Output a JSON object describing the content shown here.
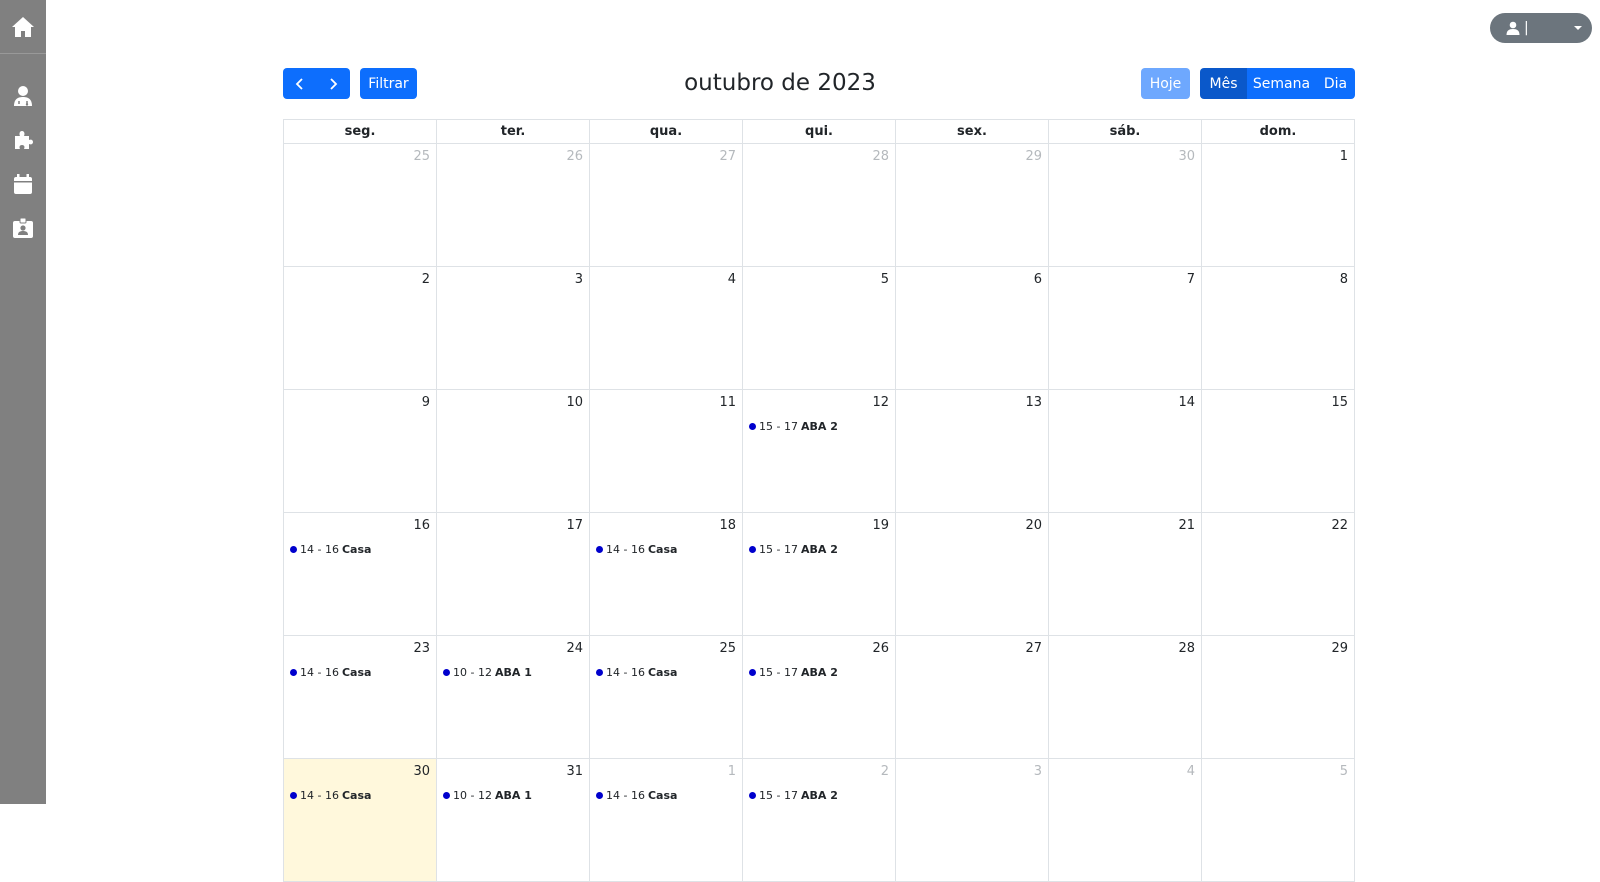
{
  "sidebar": {
    "items": [
      {
        "icon": "home-icon"
      },
      {
        "icon": "user-doctor-icon"
      },
      {
        "icon": "puzzle-icon"
      },
      {
        "icon": "calendar-icon"
      },
      {
        "icon": "id-badge-icon"
      }
    ]
  },
  "user_menu": {
    "name": "|"
  },
  "toolbar": {
    "filter_label": "Filtrar",
    "title": "outubro de 2023",
    "today_label": "Hoje",
    "views": [
      "Mês",
      "Semana",
      "Dia"
    ],
    "active_view": "Mês"
  },
  "calendar": {
    "weekdays": [
      "seg.",
      "ter.",
      "qua.",
      "qui.",
      "sex.",
      "sáb.",
      "dom."
    ],
    "weeks": [
      [
        {
          "day": "25",
          "other": true
        },
        {
          "day": "26",
          "other": true
        },
        {
          "day": "27",
          "other": true
        },
        {
          "day": "28",
          "other": true
        },
        {
          "day": "29",
          "other": true
        },
        {
          "day": "30",
          "other": true
        },
        {
          "day": "1"
        }
      ],
      [
        {
          "day": "2"
        },
        {
          "day": "3"
        },
        {
          "day": "4"
        },
        {
          "day": "5"
        },
        {
          "day": "6"
        },
        {
          "day": "7"
        },
        {
          "day": "8"
        }
      ],
      [
        {
          "day": "9"
        },
        {
          "day": "10"
        },
        {
          "day": "11"
        },
        {
          "day": "12",
          "event": {
            "time": "15 - 17",
            "title": "ABA 2"
          }
        },
        {
          "day": "13"
        },
        {
          "day": "14"
        },
        {
          "day": "15"
        }
      ],
      [
        {
          "day": "16",
          "event": {
            "time": "14 - 16",
            "title": "Casa"
          }
        },
        {
          "day": "17"
        },
        {
          "day": "18",
          "event": {
            "time": "14 - 16",
            "title": "Casa"
          }
        },
        {
          "day": "19",
          "event": {
            "time": "15 - 17",
            "title": "ABA 2"
          }
        },
        {
          "day": "20"
        },
        {
          "day": "21"
        },
        {
          "day": "22"
        }
      ],
      [
        {
          "day": "23",
          "event": {
            "time": "14 - 16",
            "title": "Casa"
          }
        },
        {
          "day": "24",
          "event": {
            "time": "10 - 12",
            "title": "ABA 1"
          }
        },
        {
          "day": "25",
          "event": {
            "time": "14 - 16",
            "title": "Casa"
          }
        },
        {
          "day": "26",
          "event": {
            "time": "15 - 17",
            "title": "ABA 2"
          }
        },
        {
          "day": "27"
        },
        {
          "day": "28"
        },
        {
          "day": "29"
        }
      ],
      [
        {
          "day": "30",
          "today": true,
          "event": {
            "time": "14 - 16",
            "title": "Casa"
          }
        },
        {
          "day": "31",
          "event": {
            "time": "10 - 12",
            "title": "ABA 1"
          }
        },
        {
          "day": "1",
          "other": true,
          "event": {
            "time": "14 - 16",
            "title": "Casa"
          }
        },
        {
          "day": "2",
          "other": true,
          "event": {
            "time": "15 - 17",
            "title": "ABA 2"
          }
        },
        {
          "day": "3",
          "other": true
        },
        {
          "day": "4",
          "other": true
        },
        {
          "day": "5",
          "other": true
        }
      ]
    ]
  },
  "colors": {
    "primary": "#0d6efd",
    "primary_dark": "#0a58ca",
    "today_button": "#6ea8fe",
    "sidebar": "#808080",
    "event_dot": "#0000cd",
    "today_cell": "#fff8dc"
  }
}
